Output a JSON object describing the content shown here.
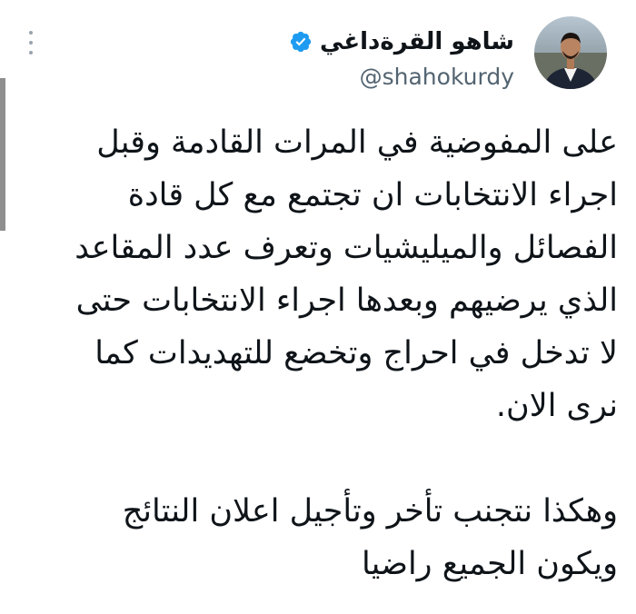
{
  "tweet": {
    "author": {
      "display_name": "شاهو القرةداغي",
      "handle": "@shahokurdy",
      "verified": true,
      "avatar_icon": "profile-photo"
    },
    "menu_icon": "more-vertical-icon",
    "verified_color": "#1d9bf0",
    "body_lines": [
      "على المفوضية في المرات القادمة وقبل",
      "اجراء الانتخابات ان تجتمع مع كل قادة",
      "الفصائل والميليشيات وتعرف عدد المقاعد",
      "الذي يرضيهم وبعدها اجراء الانتخابات حتى",
      "لا تدخل في احراج وتخضع للتهديدات كما",
      "نرى الان.",
      "",
      "وهكذا نتجنب تأخر وتأجيل اعلان النتائج",
      "ويكون الجميع راضيا"
    ]
  }
}
